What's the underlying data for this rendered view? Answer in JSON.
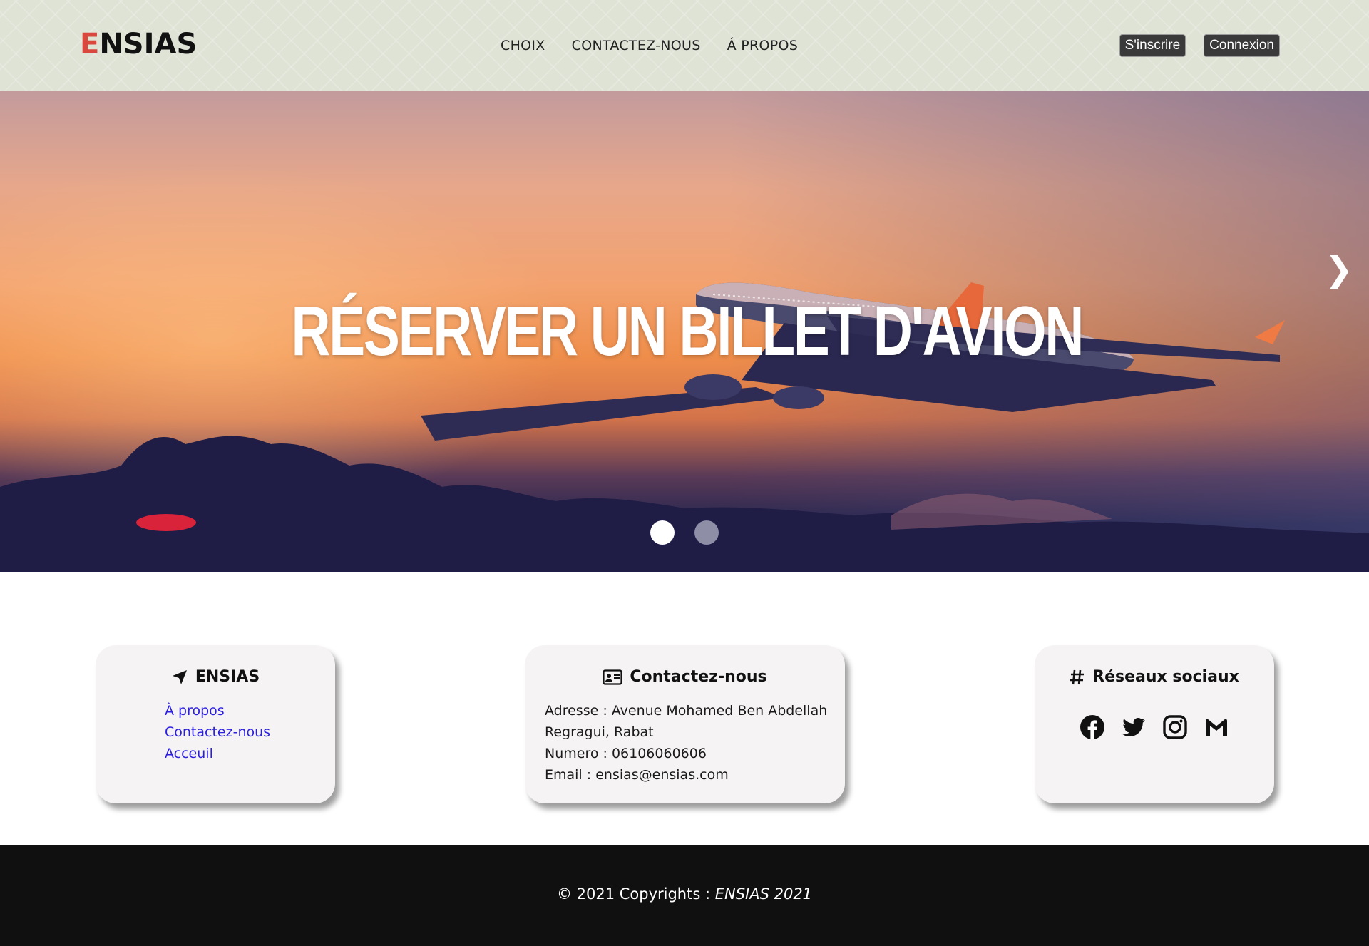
{
  "header": {
    "logo_first": "E",
    "logo_rest": "NSIAS",
    "nav": [
      "CHOIX",
      "CONTACTEZ-NOUS",
      "Á PROPOS"
    ],
    "signup_label": "S'inscrire",
    "login_label": "Connexion"
  },
  "hero": {
    "title": "RÉSERVER UN BILLET D'AVION",
    "next_icon": "chevron-right-icon",
    "slides": 2,
    "active_slide": 1
  },
  "cards": {
    "ensias": {
      "title": "ENSIAS",
      "icon": "location-arrow-icon",
      "links": [
        "À propos",
        "Contactez-nous",
        "Acceuil"
      ]
    },
    "contact": {
      "title": "Contactez-nous",
      "icon": "id-card-icon",
      "address": "Adresse : Avenue Mohamed Ben Abdellah Regragui, Rabat",
      "phone": "Numero : 06106060606",
      "email": "Email : ensias@ensias.com"
    },
    "social": {
      "title": "Réseaux sociaux",
      "icon": "hashtag-icon",
      "networks": [
        "facebook-icon",
        "twitter-icon",
        "instagram-icon",
        "gmail-icon"
      ]
    }
  },
  "footer": {
    "copyright_prefix": "© 2021 Copyrights : ",
    "copyright_brand": "ENSIAS 2021"
  },
  "colors": {
    "header_bg": "#dfe3d6",
    "logo_accent": "#d9473f",
    "link": "#2b1fe0",
    "footer_bg": "#101010",
    "card_bg": "#f5f3f3"
  }
}
